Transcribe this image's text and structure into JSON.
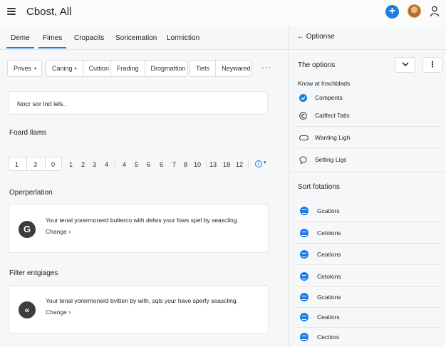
{
  "app": {
    "title": "Cbost, All"
  },
  "tabs": [
    {
      "label": "Deme"
    },
    {
      "label": "Fimes"
    },
    {
      "label": "Cropacits"
    },
    {
      "label": "Soricemation"
    },
    {
      "label": "Lormiction"
    }
  ],
  "filters": {
    "group1": [
      "Prives"
    ],
    "group2": [
      "Caning",
      "Cuttion"
    ],
    "group3": [
      "Frading",
      "Drogmattion"
    ],
    "group4": [
      "Tiets",
      "Neywared"
    ],
    "more": "···"
  },
  "search": {
    "text": "Nocr sor lnd lels.."
  },
  "sections": {
    "board": "Foard llams",
    "operation": "Operperlation",
    "filter": "Filter entgiages"
  },
  "pager": {
    "box": [
      "1",
      "3",
      "0"
    ],
    "pages": [
      "1",
      "2",
      "3",
      "4",
      "4",
      "5",
      "6",
      "6",
      "7",
      "8",
      "10",
      "13",
      "18",
      "12"
    ]
  },
  "cards": [
    {
      "icon": "G",
      "text": "Your tenal yorermonerd bulterco with delsis your fows spel by seascling.",
      "link": "Change"
    },
    {
      "icon": "«",
      "text": "Your tenal yorermonerd bvitten by with, sqls your have sperfy seascling.",
      "link": "Change"
    }
  ],
  "panel": {
    "back_label": "Optionse",
    "title": "The options",
    "subtitle": "Know at lnschblads",
    "options": [
      {
        "label": "Compents",
        "icon": "check-circle-icon"
      },
      {
        "label": "Catlfect Tatls",
        "icon": "copyright-icon"
      },
      {
        "label": "Wanting Ligh",
        "icon": "toggle-icon"
      },
      {
        "label": "Setting Ligs",
        "icon": "chat-bubble-icon"
      }
    ],
    "sort_title": "Sort fotations",
    "sort_items": [
      "Gcatiors",
      "Cetolons",
      "Ceations",
      "Cetolons",
      "Gcations",
      "Ceatiors",
      "Cectiors"
    ]
  },
  "colors": {
    "accent": "#1a7fe0"
  }
}
